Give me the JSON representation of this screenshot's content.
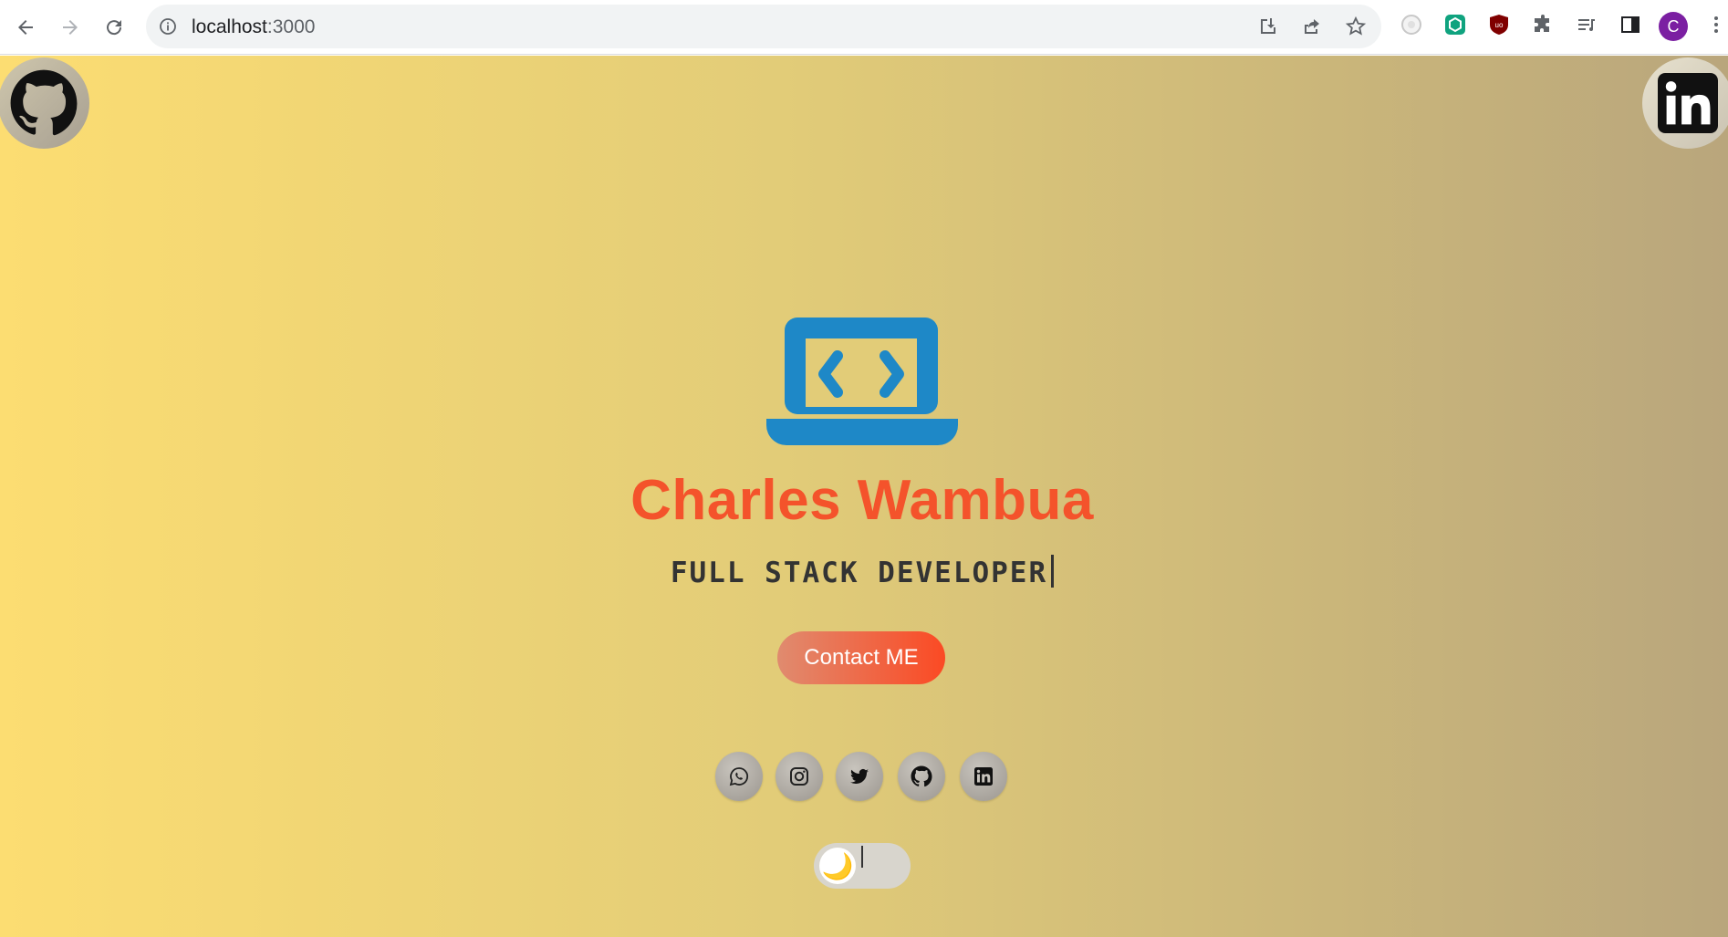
{
  "browser": {
    "url_host": "localhost",
    "url_port": ":3000",
    "profile_initial": "C"
  },
  "social_links": {
    "corner_left_icon": "github-icon",
    "corner_right_icon": "linkedin-icon",
    "footer": [
      "whatsapp-icon",
      "instagram-icon",
      "twitter-icon",
      "github-icon",
      "linkedin-icon"
    ]
  },
  "hero": {
    "icon": "laptop-code-icon",
    "name": "Charles Wambua",
    "role": "FULL STACK DEVELOPER",
    "contact_label": "Contact ME"
  },
  "theme_toggle": {
    "icon": "moon-icon",
    "icon_glyph": "🌙"
  },
  "colors": {
    "name": "#f4532b",
    "laptop_icon": "#1e88c7",
    "gradient_start": "#fcdd72",
    "gradient_end": "#b9a67c",
    "button_start": "#e08b6f",
    "button_end": "#fb4a24"
  }
}
